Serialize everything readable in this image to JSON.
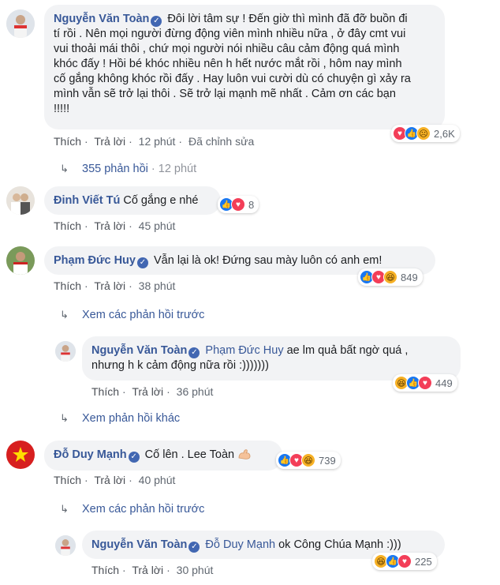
{
  "comments": {
    "c1": {
      "author": "Nguyễn Văn Toàn",
      "lines": [
        "Đôi lời tâm sự ! Đến giờ thì mình đã đỡ buồn đi",
        "tí rồi . Nên mọi người đừng động viên mình nhiều nữa , ở đây cmt vui",
        "vui thoải mái thôi , chứ mọi người nói nhiều câu cảm động quá mình",
        "khóc đấy ! Hồi bé khóc nhiều nên h hết nước mắt rồi , hôm nay mình",
        "cố gắng không khóc rồi đấy . Hay luôn vui cười dù có chuyện gì xảy ra",
        "mình vẫn sẽ trở lại thôi . Sẽ trở lại mạnh mẽ nhất . Cảm ơn các bạn",
        "!!!!!"
      ],
      "reactions": "2,6K",
      "like": "Thích",
      "reply": "Trả lời",
      "time": "12 phút",
      "edited": "Đã chỉnh sửa",
      "replies": "355 phản hồi",
      "replies_time": "12 phút"
    },
    "c2": {
      "author": "Đinh Viết Tú",
      "text": "Cố gắng e nhé",
      "reactions": "8",
      "like": "Thích",
      "reply": "Trả lời",
      "time": "45 phút"
    },
    "c3": {
      "author": "Phạm Đức Huy",
      "text": "Vẫn lại là ok! Đứng sau mày luôn có anh em!",
      "reactions": "849",
      "like": "Thích",
      "reply": "Trả lời",
      "time": "38 phút",
      "prev": "Xem các phản hồi trước",
      "reply1": {
        "author": "Nguyễn Văn Toàn",
        "tag": "Phạm Đức Huy",
        "text1": "ae lm quả bất ngờ quá ,",
        "text2": "nhưng h k cảm động nữa rồi :)))))))",
        "reactions": "449",
        "like": "Thích",
        "reply": "Trả lời",
        "time": "36 phút"
      },
      "more": "Xem phản hồi khác"
    },
    "c4": {
      "author": "Đỗ Duy Mạnh",
      "text": "Cố lên . Lee Toàn",
      "reactions": "739",
      "like": "Thích",
      "reply": "Trả lời",
      "time": "40 phút",
      "prev": "Xem các phản hồi trước",
      "reply1": {
        "author": "Nguyễn Văn Toàn",
        "tag": "Đỗ Duy Mạnh",
        "text": "ok Công Chúa Mạnh :)))",
        "reactions": "225",
        "like": "Thích",
        "reply": "Trả lời",
        "time": "30 phút"
      }
    }
  },
  "icons": {
    "verified": "check-icon",
    "like": "thumbs-up-icon",
    "love": "heart-icon",
    "haha": "laugh-icon",
    "sad": "sad-icon",
    "reply_arrow": "reply-arrow-icon",
    "muscle": "flexed-biceps-icon"
  },
  "colors": {
    "link": "#385898",
    "bubble": "#f2f3f5",
    "meta": "#606770",
    "like": "#1877f2",
    "love": "#f33e58",
    "emoji": "#f7b125"
  }
}
